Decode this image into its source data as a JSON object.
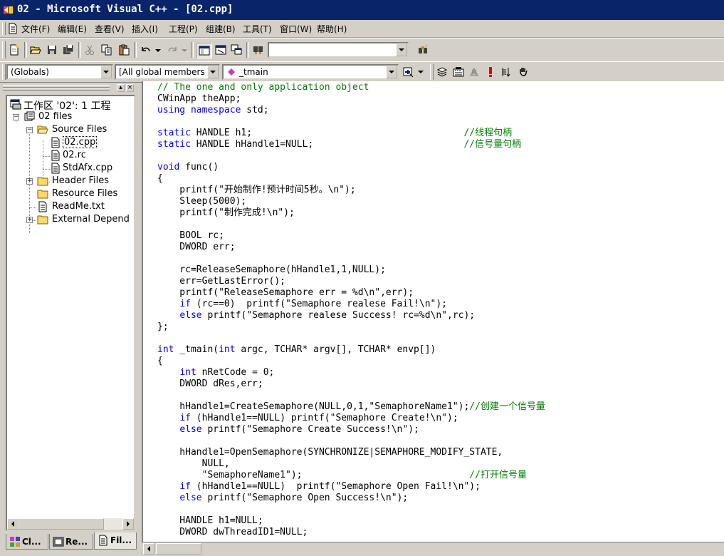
{
  "window": {
    "title": "02 - Microsoft Visual C++ - [02.cpp]"
  },
  "menu": [
    {
      "label": "文件(F)"
    },
    {
      "label": "编辑(E)"
    },
    {
      "label": "查看(V)"
    },
    {
      "label": "插入(I)"
    },
    {
      "label": "工程(P)"
    },
    {
      "label": "组建(B)"
    },
    {
      "label": "工具(T)"
    },
    {
      "label": "窗口(W)"
    },
    {
      "label": "帮助(H)"
    }
  ],
  "wizardbar": {
    "class_combo": "(Globals)",
    "filter_combo": "[All global members",
    "member_combo": "_tmain"
  },
  "find_combo": {
    "value": ""
  },
  "workspace": {
    "tree": [
      {
        "label": "工作区 '02': 1 工程",
        "icon": "workspace-icon"
      },
      {
        "label": "02 files",
        "icon": "project-icon"
      },
      {
        "label": "Source Files",
        "icon": "folder-open-icon"
      },
      {
        "label": "02.cpp",
        "icon": "cpp-file-icon"
      },
      {
        "label": "02.rc",
        "icon": "rc-file-icon"
      },
      {
        "label": "StdAfx.cpp",
        "icon": "cpp-file-icon"
      },
      {
        "label": "Header Files",
        "icon": "folder-icon"
      },
      {
        "label": "Resource Files",
        "icon": "folder-icon"
      },
      {
        "label": "ReadMe.txt",
        "icon": "text-file-icon"
      },
      {
        "label": "External Depend",
        "icon": "folder-icon"
      }
    ],
    "tabs": [
      {
        "label": "Cl..."
      },
      {
        "label": "Re..."
      },
      {
        "label": "Fil..."
      }
    ]
  },
  "editor": {
    "lines": [
      [
        [
          "cm",
          "// The one and only application object"
        ]
      ],
      [
        [
          "",
          "CWinApp theApp;"
        ]
      ],
      [
        [
          "kw",
          "using"
        ],
        [
          "",
          "",
          " "
        ],
        [
          "kw",
          "namespace"
        ],
        [
          "",
          " std;"
        ]
      ],
      [],
      [
        [
          "kw",
          "static"
        ],
        [
          "",
          " HANDLE h1;                                      "
        ],
        [
          "cm",
          "//线程句柄"
        ]
      ],
      [
        [
          "kw",
          "static"
        ],
        [
          "",
          " HANDLE hHandle1=NULL;                           "
        ],
        [
          "cm",
          "//信号量句柄"
        ]
      ],
      [],
      [
        [
          "kw",
          "void"
        ],
        [
          "",
          " func()"
        ]
      ],
      [
        [
          "",
          "{"
        ]
      ],
      [
        [
          "",
          "    printf(\"开始制作!预计时间5秒。\\n\");"
        ]
      ],
      [
        [
          "",
          "    Sleep(5000);"
        ]
      ],
      [
        [
          "",
          "    printf(\"制作完成!\\n\");"
        ]
      ],
      [],
      [
        [
          "",
          "    BOOL rc;"
        ]
      ],
      [
        [
          "",
          "    DWORD err;"
        ]
      ],
      [],
      [
        [
          "",
          "    rc=ReleaseSemaphore(hHandle1,1,NULL);"
        ]
      ],
      [
        [
          "",
          "    err=GetLastError();"
        ]
      ],
      [
        [
          "",
          "    printf(\"ReleaseSemaphore err = %d\\n\",err);"
        ]
      ],
      [
        [
          "",
          "    "
        ],
        [
          "kw",
          "if"
        ],
        [
          "",
          " (rc==0)  printf(\"Semaphore realese Fail!\\n\");"
        ]
      ],
      [
        [
          "",
          "    "
        ],
        [
          "kw",
          "else"
        ],
        [
          "",
          " printf(\"Semaphore realese Success! rc=%d\\n\",rc);"
        ]
      ],
      [
        [
          "",
          "};"
        ]
      ],
      [],
      [
        [
          "kw",
          "int"
        ],
        [
          "",
          " _tmain("
        ],
        [
          "kw",
          "int"
        ],
        [
          "",
          " argc, TCHAR* argv[], TCHAR* envp[])"
        ]
      ],
      [
        [
          "",
          "{"
        ]
      ],
      [
        [
          "",
          "    "
        ],
        [
          "kw",
          "int"
        ],
        [
          "",
          " nRetCode = 0;"
        ]
      ],
      [
        [
          "",
          "    DWORD dRes,err;"
        ]
      ],
      [],
      [
        [
          "",
          "    hHandle1=CreateSemaphore(NULL,0,1,\"SemaphoreName1\");"
        ],
        [
          "cm",
          "//创建一个信号量"
        ]
      ],
      [
        [
          "",
          "    "
        ],
        [
          "kw",
          "if"
        ],
        [
          "",
          " (hHandle1==NULL) printf(\"Semaphore Create!\\n\");"
        ]
      ],
      [
        [
          "",
          "    "
        ],
        [
          "kw",
          "else"
        ],
        [
          "",
          " printf(\"Semaphore Create Success!\\n\");"
        ]
      ],
      [],
      [
        [
          "",
          "    hHandle1=OpenSemaphore(SYNCHRONIZE|SEMAPHORE_MODIFY_STATE,"
        ]
      ],
      [
        [
          "",
          "        NULL,"
        ]
      ],
      [
        [
          "",
          "        \"SemaphoreName1\");                              "
        ],
        [
          "cm",
          "//打开信号量"
        ]
      ],
      [
        [
          "",
          "    "
        ],
        [
          "kw",
          "if"
        ],
        [
          "",
          " (hHandle1==NULL)  printf(\"Semaphore Open Fail!\\n\");"
        ]
      ],
      [
        [
          "",
          "    "
        ],
        [
          "kw",
          "else"
        ],
        [
          "",
          " printf(\"Semaphore Open Success!\\n\");"
        ]
      ],
      [],
      [
        [
          "",
          "    HANDLE h1=NULL;"
        ]
      ],
      [
        [
          "",
          "    DWORD dwThreadID1=NULL;"
        ]
      ]
    ]
  }
}
